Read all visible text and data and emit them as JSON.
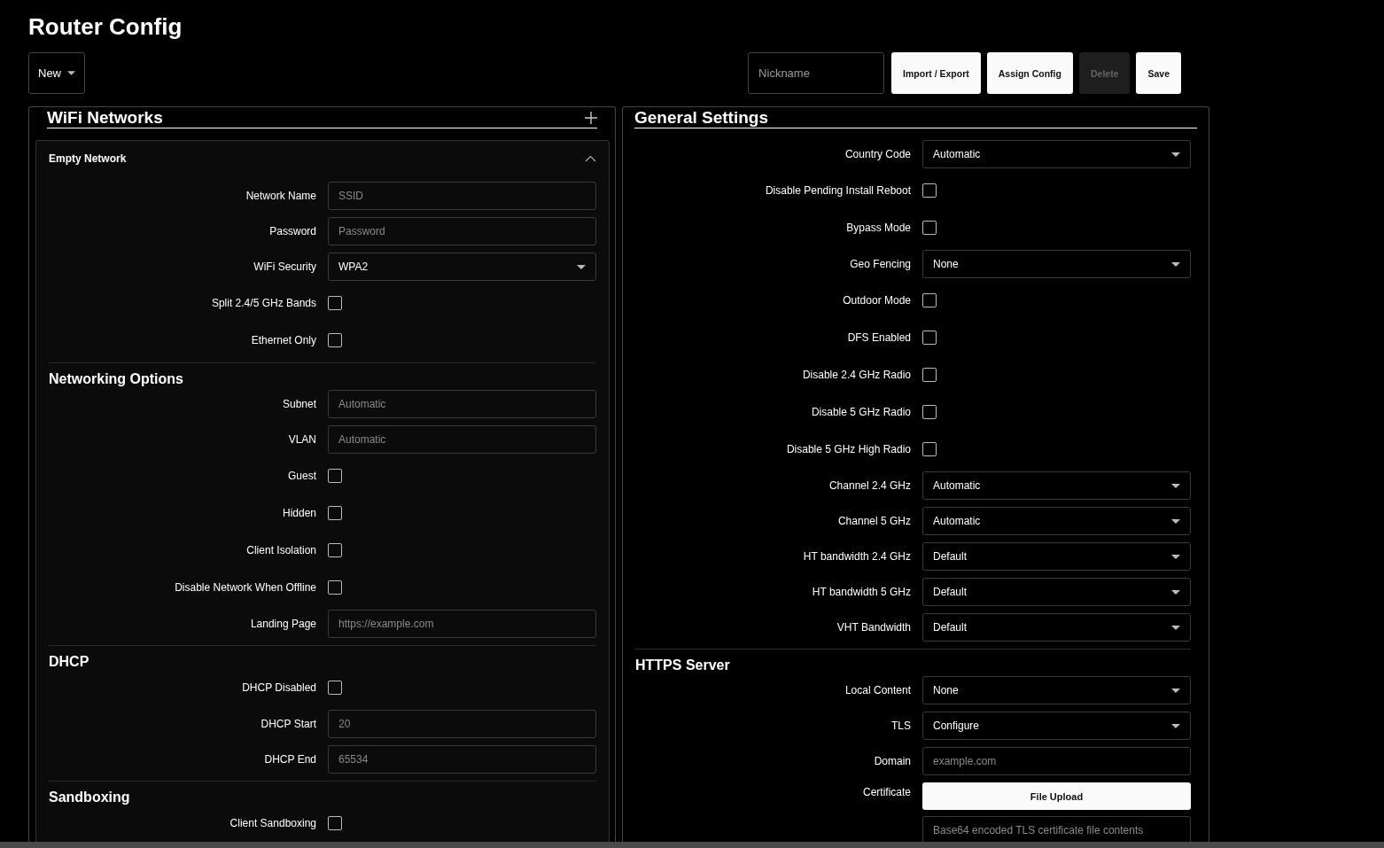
{
  "title": "Router Config",
  "toolbar": {
    "menu": {
      "label": "New"
    },
    "nickname": {
      "placeholder": "Nickname"
    },
    "buttons": [
      {
        "label": "Import / Export",
        "disabled": false
      },
      {
        "label": "Assign Config",
        "disabled": false
      },
      {
        "label": "Delete",
        "disabled": true
      },
      {
        "label": "Save",
        "disabled": false
      }
    ]
  },
  "wifi": {
    "title": "WiFi Networks",
    "network": {
      "title": "Empty Network",
      "expanded": true,
      "groups": [
        {
          "rows": [
            {
              "kind": "text",
              "label": "Network Name",
              "placeholder": "SSID"
            },
            {
              "kind": "text",
              "label": "Password",
              "placeholder": "Password"
            },
            {
              "kind": "select",
              "label": "WiFi Security",
              "value": "WPA2"
            },
            {
              "kind": "checkbox",
              "label": "Split 2.4/5 GHz Bands",
              "checked": false
            },
            {
              "kind": "checkbox",
              "label": "Ethernet Only",
              "checked": false
            }
          ]
        },
        {
          "heading": "Networking Options",
          "rows": [
            {
              "kind": "text",
              "label": "Subnet",
              "placeholder": "Automatic"
            },
            {
              "kind": "text",
              "label": "VLAN",
              "placeholder": "Automatic"
            },
            {
              "kind": "checkbox",
              "label": "Guest",
              "checked": false
            },
            {
              "kind": "checkbox",
              "label": "Hidden",
              "checked": false
            },
            {
              "kind": "checkbox",
              "label": "Client Isolation",
              "checked": false
            },
            {
              "kind": "checkbox",
              "label": "Disable Network When Offline",
              "checked": false
            },
            {
              "kind": "text",
              "label": "Landing Page",
              "placeholder": "https://example.com"
            }
          ]
        },
        {
          "heading": "DHCP",
          "rows": [
            {
              "kind": "checkbox",
              "label": "DHCP Disabled",
              "checked": false
            },
            {
              "kind": "text",
              "label": "DHCP Start",
              "placeholder": "20"
            },
            {
              "kind": "text",
              "label": "DHCP End",
              "placeholder": "65534"
            }
          ]
        },
        {
          "heading": "Sandboxing",
          "rows": [
            {
              "kind": "checkbox",
              "label": "Client Sandboxing",
              "checked": false
            }
          ]
        }
      ]
    }
  },
  "general": {
    "title": "General Settings",
    "groups": [
      {
        "rows": [
          {
            "kind": "select",
            "label": "Country Code",
            "value": "Automatic"
          },
          {
            "kind": "checkbox",
            "label": "Disable Pending Install Reboot",
            "checked": false
          },
          {
            "kind": "checkbox",
            "label": "Bypass Mode",
            "checked": false
          },
          {
            "kind": "select",
            "label": "Geo Fencing",
            "value": "None"
          },
          {
            "kind": "checkbox",
            "label": "Outdoor Mode",
            "checked": false
          },
          {
            "kind": "checkbox",
            "label": "DFS Enabled",
            "checked": false
          },
          {
            "kind": "checkbox",
            "label": "Disable 2.4 GHz Radio",
            "checked": false
          },
          {
            "kind": "checkbox",
            "label": "Disable 5 GHz Radio",
            "checked": false
          },
          {
            "kind": "checkbox",
            "label": "Disable 5 GHz High Radio",
            "checked": false
          },
          {
            "kind": "select",
            "label": "Channel 2.4 GHz",
            "value": "Automatic"
          },
          {
            "kind": "select",
            "label": "Channel 5 GHz",
            "value": "Automatic"
          },
          {
            "kind": "select",
            "label": "HT bandwidth 2.4 GHz",
            "value": "Default"
          },
          {
            "kind": "select",
            "label": "HT bandwidth 5 GHz",
            "value": "Default"
          },
          {
            "kind": "select",
            "label": "VHT Bandwidth",
            "value": "Default"
          }
        ]
      },
      {
        "heading": "HTTPS Server",
        "rows": [
          {
            "kind": "select",
            "label": "Local Content",
            "value": "None"
          },
          {
            "kind": "select",
            "label": "TLS",
            "value": "Configure"
          },
          {
            "kind": "text",
            "label": "Domain",
            "placeholder": "example.com"
          },
          {
            "kind": "upload",
            "label": "Certificate",
            "button": "File Upload",
            "placeholder": "Base64 encoded TLS certificate file contents"
          }
        ]
      }
    ]
  }
}
